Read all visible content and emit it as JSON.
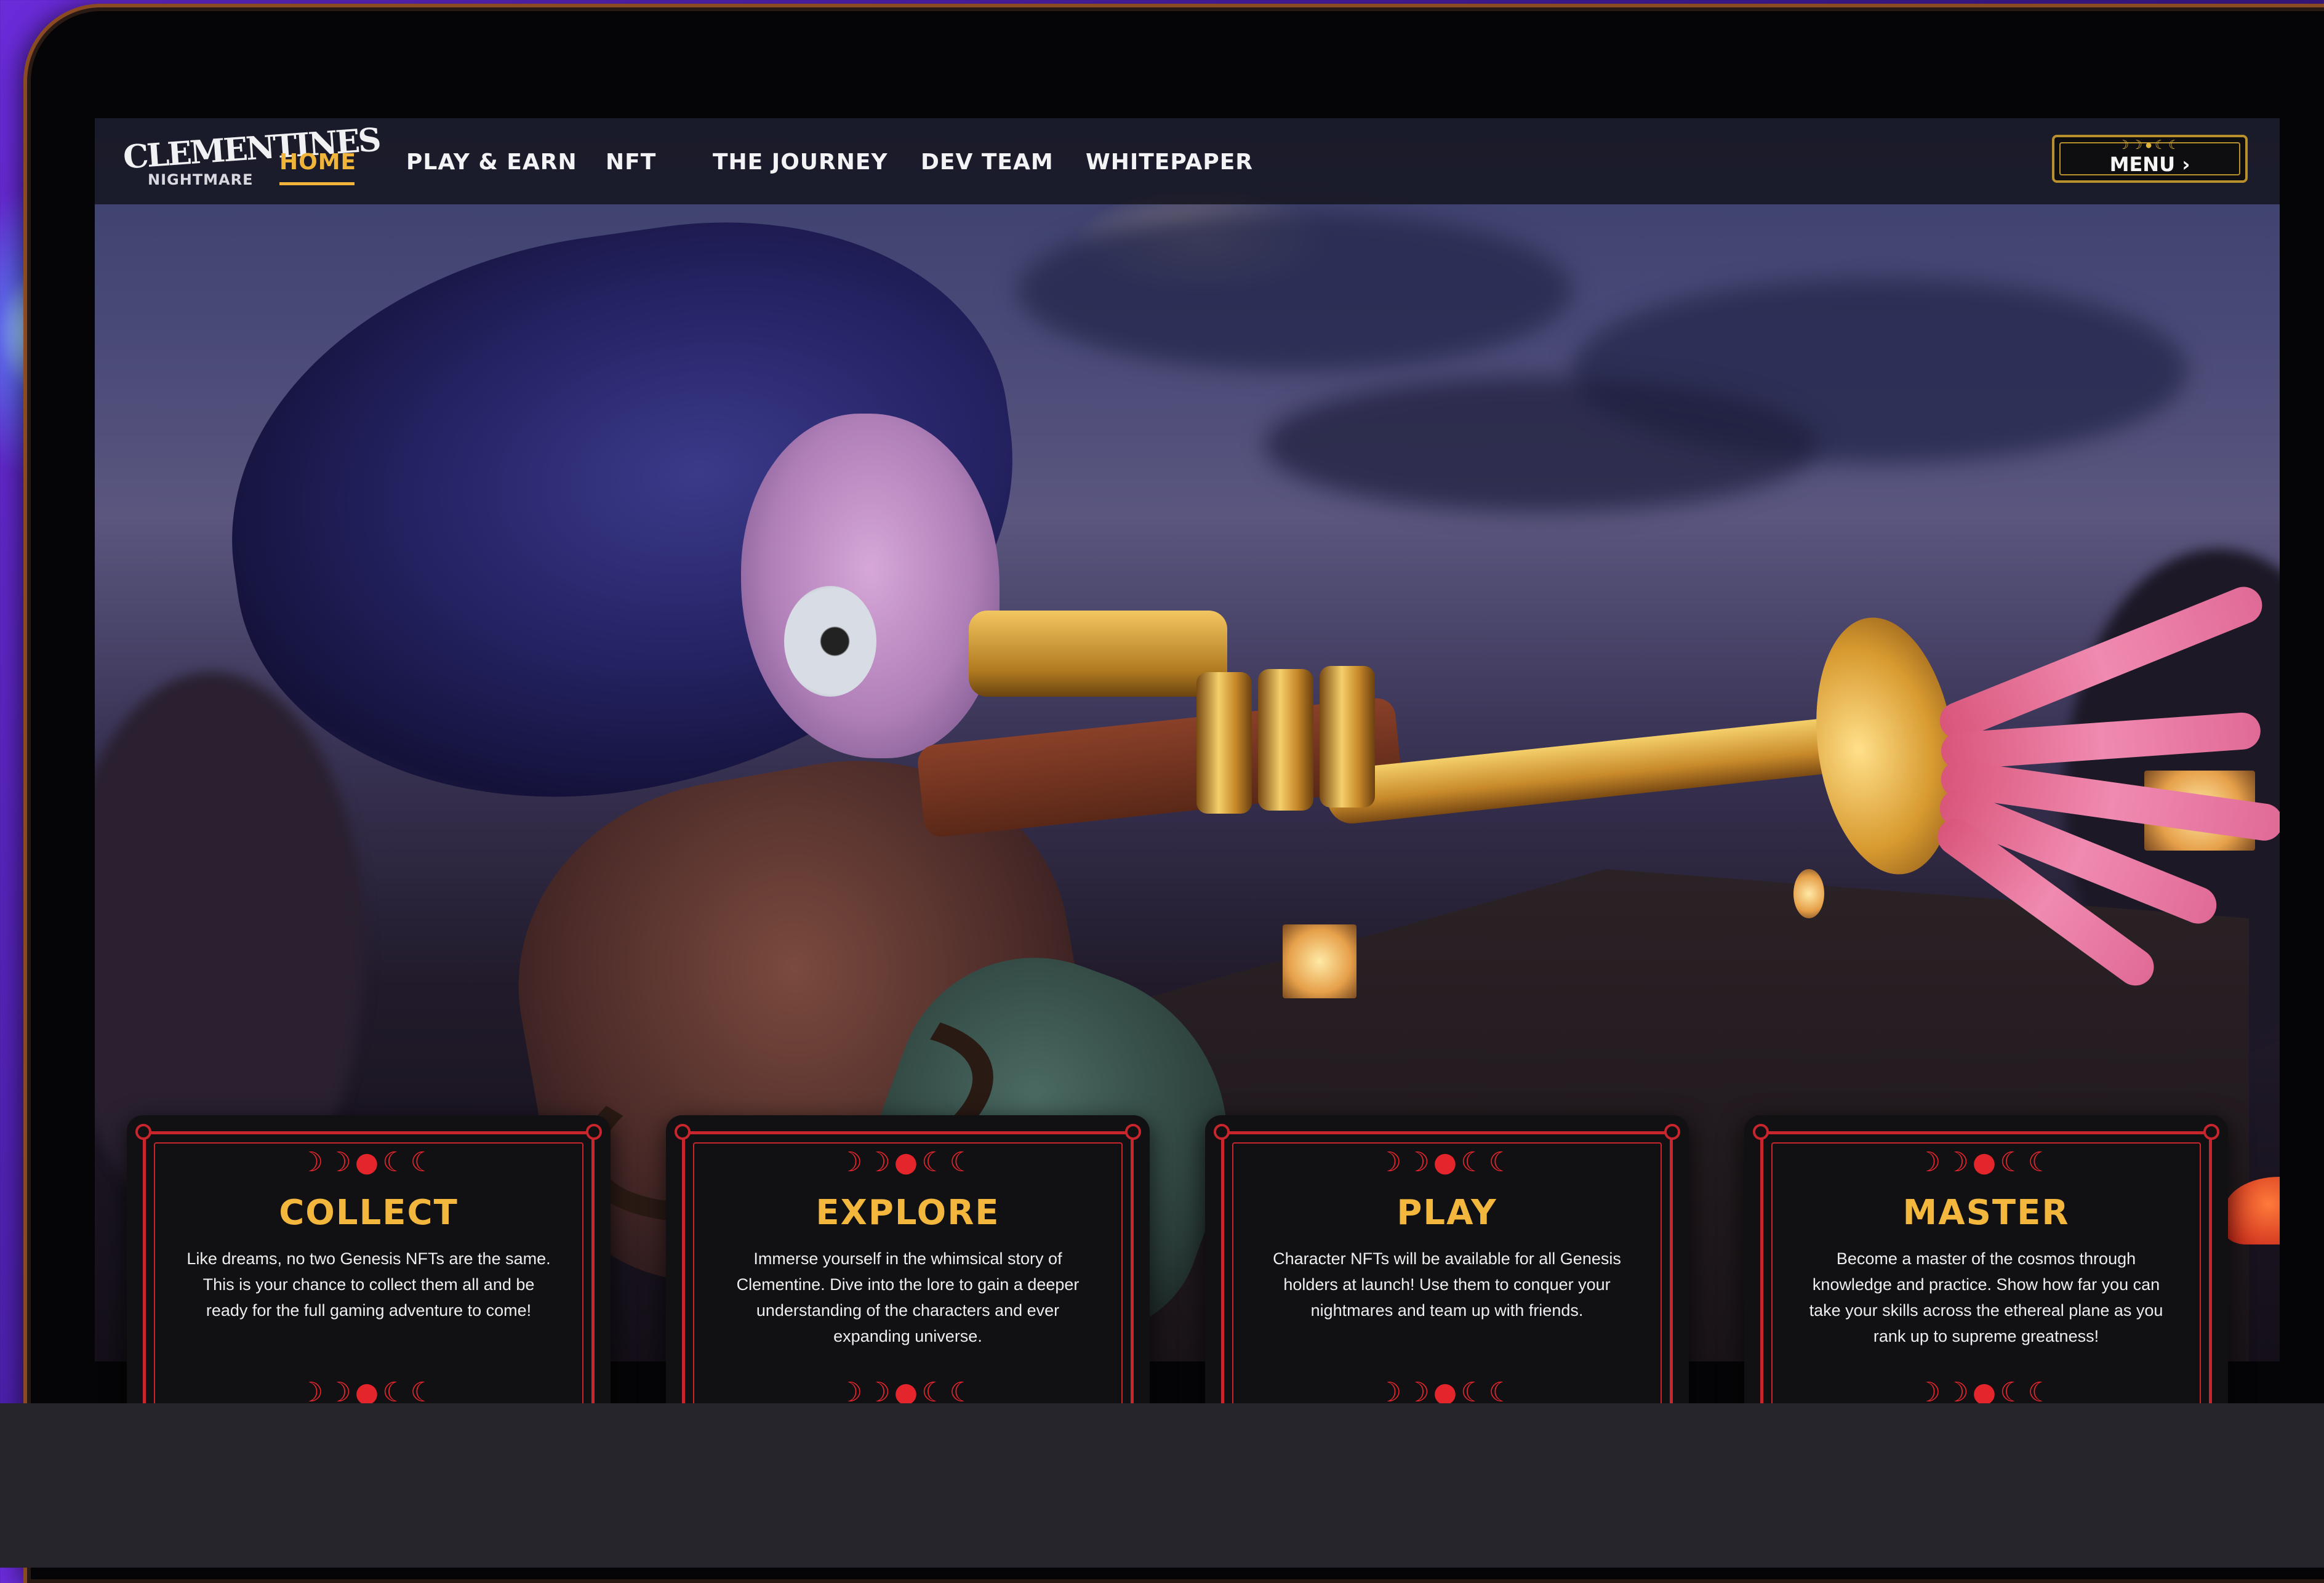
{
  "brand": {
    "logo_line1": "CLEMENTINES",
    "logo_line2": "NIGHTMARE"
  },
  "nav": {
    "items": [
      {
        "label": "HOME",
        "active": true
      },
      {
        "label": "PLAY & EARN",
        "active": false
      },
      {
        "label": "NFT",
        "active": false
      },
      {
        "label": "THE JOURNEY",
        "active": false
      },
      {
        "label": "DEV TEAM",
        "active": false
      },
      {
        "label": "WHITEPAPER",
        "active": false
      }
    ],
    "menu_label": "MENU ›",
    "menu_ornament": "☽☽●☾☾"
  },
  "cards": [
    {
      "ornament": "☽☽●☾☾",
      "title": "COLLECT",
      "body": "Like dreams, no two Genesis NFTs are the same. This is your chance to collect them all and be ready for the full gaming adventure to come!"
    },
    {
      "ornament": "☽☽●☾☾",
      "title": "EXPLORE",
      "body": "Immerse yourself in the whimsical story of Clementine. Dive into the lore to gain a deeper understanding of the characters and ever expanding universe."
    },
    {
      "ornament": "☽☽●☾☾",
      "title": "PLAY",
      "body": "Character NFTs will be available for all Genesis holders at launch! Use them to conquer your nightmares and team up with friends."
    },
    {
      "ornament": "☽☽●☾☾",
      "title": "MASTER",
      "body": "Become a master of the cosmos through knowledge and practice. Show how far you can take your skills across the ethereal plane as you rank up to supreme greatness!"
    }
  ],
  "colors": {
    "accent_gold": "#f0b43a",
    "card_red": "#c8252c",
    "background_purple": "#5a24c4"
  }
}
